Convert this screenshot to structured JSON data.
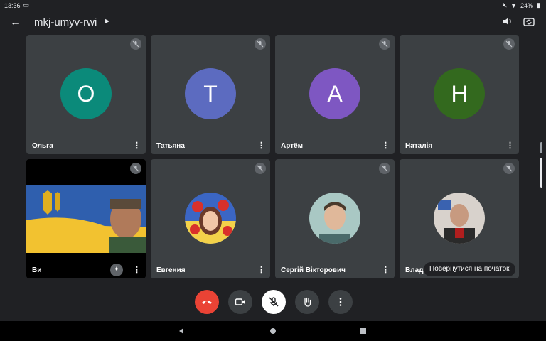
{
  "statusbar": {
    "time": "13:36",
    "battery": "24%"
  },
  "header": {
    "meeting_code": "mkj-umyv-rwi"
  },
  "participants": [
    {
      "name": "Ольга",
      "initial": "O",
      "color": "#0b8a7a"
    },
    {
      "name": "Татьяна",
      "initial": "T",
      "color": "#5c6bc0"
    },
    {
      "name": "Артём",
      "initial": "A",
      "color": "#7e57c2"
    },
    {
      "name": "Наталія",
      "initial": "H",
      "color": "#33691e"
    },
    {
      "name": "Ви"
    },
    {
      "name": "Евгения"
    },
    {
      "name": "Сергій  Вікторович"
    },
    {
      "name": "Влади"
    }
  ],
  "tooltip": "Повернутися на початок",
  "colors": {
    "background": "#202124",
    "tile": "#3c4043",
    "end_call": "#ea4335",
    "mic_off": "#ffffff"
  },
  "icons": {
    "back": "arrow-left-icon",
    "speaker": "speaker-icon",
    "switch_camera": "switch-camera-icon",
    "mic_off": "mic-off-icon",
    "more": "more-vert-icon",
    "end_call": "end-call-icon",
    "camera": "video-camera-icon",
    "hand": "raise-hand-icon",
    "effects": "sparkle-effects-icon"
  }
}
